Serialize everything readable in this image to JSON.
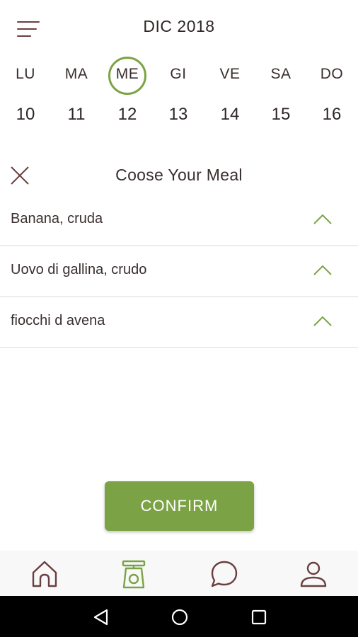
{
  "header": {
    "month_label": "DIC 2018"
  },
  "week": {
    "days": [
      {
        "name": "LU",
        "num": "10",
        "selected": false
      },
      {
        "name": "MA",
        "num": "11",
        "selected": false
      },
      {
        "name": "ME",
        "num": "12",
        "selected": true
      },
      {
        "name": "GI",
        "num": "13",
        "selected": false
      },
      {
        "name": "VE",
        "num": "14",
        "selected": false
      },
      {
        "name": "SA",
        "num": "15",
        "selected": false
      },
      {
        "name": "DO",
        "num": "16",
        "selected": false
      }
    ]
  },
  "meal": {
    "title": "Coose Your Meal",
    "items": [
      {
        "name": "Banana, cruda"
      },
      {
        "name": "Uovo di gallina, crudo"
      },
      {
        "name": "fiocchi d avena"
      }
    ]
  },
  "confirm_label": "CONFIRM",
  "tabbar": {
    "tabs": [
      {
        "icon": "home-icon",
        "active": false
      },
      {
        "icon": "scale-icon",
        "active": true
      },
      {
        "icon": "chat-bubble-icon",
        "active": false
      },
      {
        "icon": "user-icon",
        "active": false
      }
    ]
  },
  "colors": {
    "accent": "#7ba345",
    "icon": "#6b3f3f",
    "text": "#3a2e2e"
  }
}
